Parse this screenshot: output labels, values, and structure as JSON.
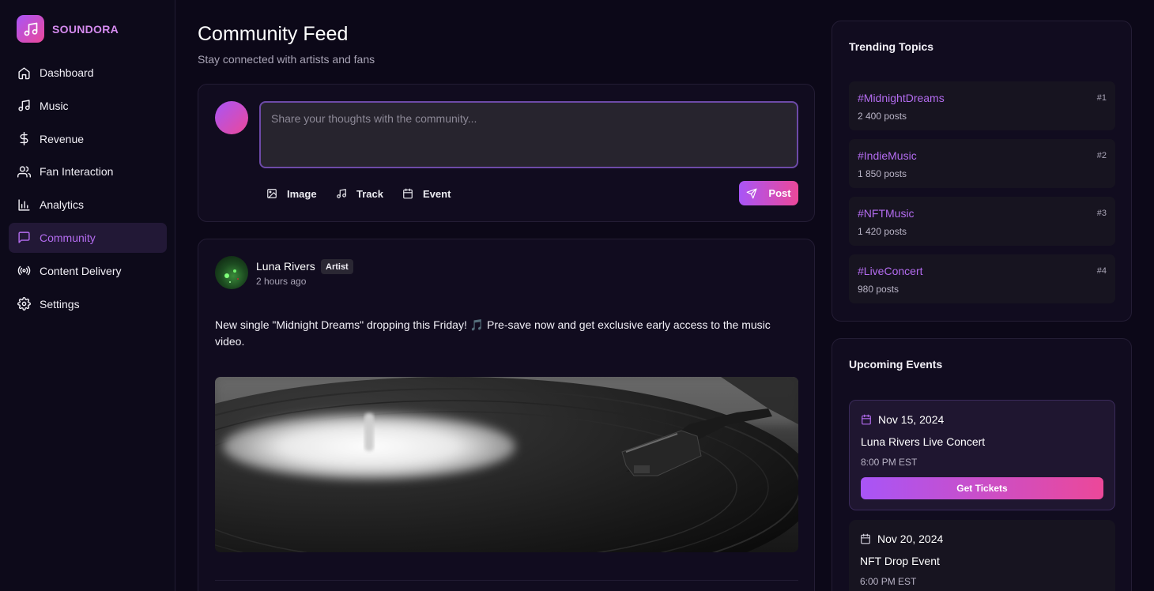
{
  "brand": {
    "name": "SOUNDORA",
    "logo_icon": "music-note-icon"
  },
  "nav": {
    "items": [
      {
        "label": "Dashboard",
        "icon": "home-icon",
        "active": false
      },
      {
        "label": "Music",
        "icon": "music-note-icon",
        "active": false
      },
      {
        "label": "Revenue",
        "icon": "dollar-icon",
        "active": false
      },
      {
        "label": "Fan Interaction",
        "icon": "users-icon",
        "active": false
      },
      {
        "label": "Analytics",
        "icon": "bar-chart-icon",
        "active": false
      },
      {
        "label": "Community",
        "icon": "message-square-icon",
        "active": true
      },
      {
        "label": "Content Delivery",
        "icon": "broadcast-icon",
        "active": false
      },
      {
        "label": "Settings",
        "icon": "gear-icon",
        "active": false
      }
    ]
  },
  "page": {
    "title": "Community Feed",
    "subtitle": "Stay connected with artists and fans"
  },
  "composer": {
    "placeholder": "Share your thoughts with the community...",
    "image_label": "Image",
    "track_label": "Track",
    "event_label": "Event",
    "post_label": "Post"
  },
  "post": {
    "author": "Luna Rivers",
    "badge": "Artist",
    "time": "2 hours ago",
    "text": "New single \"Midnight Dreams\" dropping this Friday! 🎵 Pre-save now and get exclusive early access to the music video."
  },
  "trending": {
    "title": "Trending Topics",
    "topics": [
      {
        "tag": "#MidnightDreams",
        "posts": "2 400 posts",
        "rank": "#1"
      },
      {
        "tag": "#IndieMusic",
        "posts": "1 850 posts",
        "rank": "#2"
      },
      {
        "tag": "#NFTMusic",
        "posts": "1 420 posts",
        "rank": "#3"
      },
      {
        "tag": "#LiveConcert",
        "posts": "980 posts",
        "rank": "#4"
      }
    ]
  },
  "events": {
    "title": "Upcoming Events",
    "items": [
      {
        "date": "Nov 15, 2024",
        "name": "Luna Rivers Live Concert",
        "time": "8:00 PM EST",
        "button": "Get Tickets"
      },
      {
        "date": "Nov 20, 2024",
        "name": "NFT Drop Event",
        "time": "6:00 PM EST"
      }
    ]
  },
  "colors": {
    "accent": "#a855f7",
    "accent2": "#ec4899",
    "active_text": "#b46cf0",
    "background": "#0c0818"
  }
}
